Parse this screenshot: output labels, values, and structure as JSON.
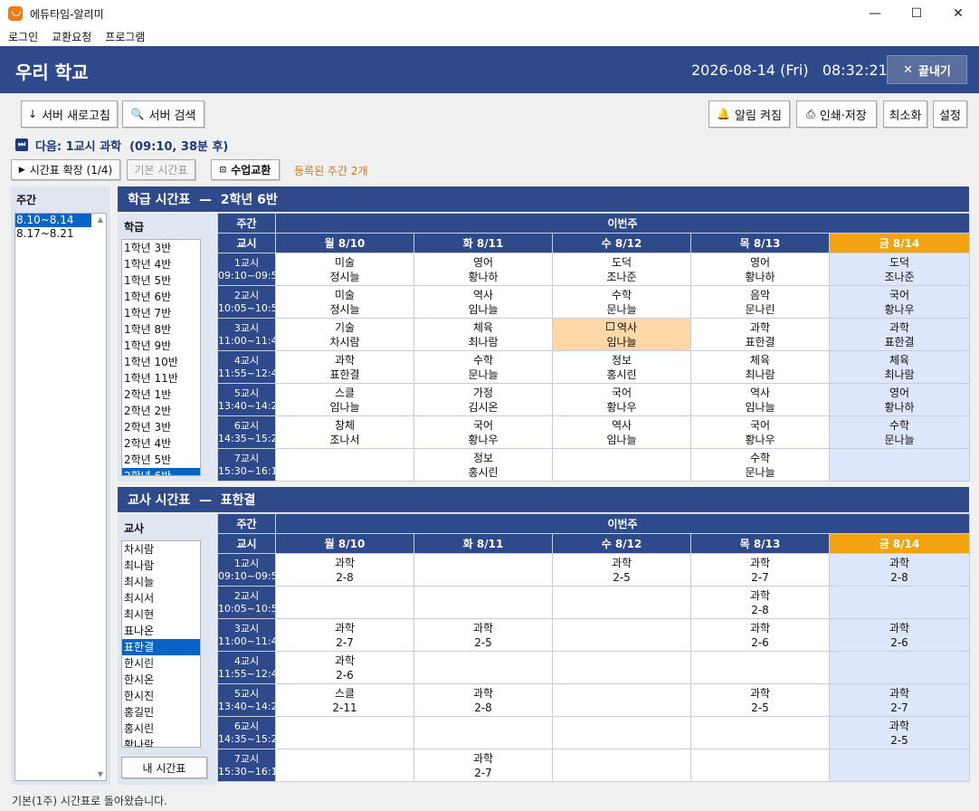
{
  "window": {
    "title": "에듀타임-알리미",
    "minimize": "—",
    "maximize": "☐",
    "close": "✕"
  },
  "menu": [
    "로그인",
    "교환요청",
    "프로그램"
  ],
  "header": {
    "school": "우리 학교",
    "datetime": "2026-08-14 (Fri)   08:32:21",
    "exit_label": "끝내기"
  },
  "toolbar": {
    "refresh": "서버 새로고침",
    "search": "서버 검색",
    "alarm": "알림 켜짐",
    "print": "인쇄·저장",
    "minimize": "최소화",
    "settings": "설정"
  },
  "next_info": "다음: 1교시 과학  (09:10, 38분 후)",
  "sub_toolbar": {
    "expand": "시간표 확장 (1/4)",
    "basic": "기본 시간표",
    "swap": "수업교환",
    "registered": "등록된 주간 2개"
  },
  "weeks": {
    "label": "주간",
    "items": [
      "8.10~8.14",
      "8.17~8.21"
    ],
    "selected": 0
  },
  "class_section": {
    "title": "학급 시간표  —  2학년 6반",
    "list_label": "학급",
    "list": [
      "1학년 3반",
      "1학년 4반",
      "1학년 5반",
      "1학년 6반",
      "1학년 7반",
      "1학년 8반",
      "1학년 9반",
      "1학년 10반",
      "1학년 11반",
      "2학년 1반",
      "2학년 2반",
      "2학년 3반",
      "2학년 4반",
      "2학년 5반",
      "2학년 6반"
    ],
    "selected": 14
  },
  "teacher_section": {
    "title": "교사 시간표  —  표한결",
    "list_label": "교사",
    "list": [
      "차시람",
      "최나람",
      "최시늘",
      "최시서",
      "최시현",
      "표나온",
      "표한결",
      "한시린",
      "한시온",
      "한시진",
      "홍길민",
      "홍시린",
      "황나람"
    ],
    "selected": 6,
    "my_timetable": "내 시간표"
  },
  "grid_header": {
    "week_col": "주간",
    "week_name": "이번주",
    "period_col": "교시",
    "days": [
      "월 8/10",
      "화 8/11",
      "수 8/12",
      "목 8/13",
      "금 8/14"
    ],
    "today_index": 4
  },
  "periods": [
    {
      "name": "1교시",
      "time": "09:10~09:55"
    },
    {
      "name": "2교시",
      "time": "10:05~10:50"
    },
    {
      "name": "3교시",
      "time": "11:00~11:45"
    },
    {
      "name": "4교시",
      "time": "11:55~12:40"
    },
    {
      "name": "5교시",
      "time": "13:40~14:25"
    },
    {
      "name": "6교시",
      "time": "14:35~15:20"
    },
    {
      "name": "7교시",
      "time": "15:30~16:15"
    }
  ],
  "class_grid": [
    [
      [
        "미술",
        "정시늘"
      ],
      [
        "영어",
        "황나하"
      ],
      [
        "도덕",
        "조나준"
      ],
      [
        "영어",
        "황나하"
      ],
      [
        "도덕",
        "조나준"
      ]
    ],
    [
      [
        "미술",
        "정시늘"
      ],
      [
        "역사",
        "임나늘"
      ],
      [
        "수학",
        "문나늘"
      ],
      [
        "음악",
        "문나린"
      ],
      [
        "국어",
        "황나우"
      ]
    ],
    [
      [
        "기술",
        "차시람"
      ],
      [
        "체육",
        "최나람"
      ],
      [
        "역사",
        "임나늘"
      ],
      [
        "과학",
        "표한결"
      ],
      [
        "과학",
        "표한결"
      ]
    ],
    [
      [
        "과학",
        "표한결"
      ],
      [
        "수학",
        "문나늘"
      ],
      [
        "정보",
        "홍시린"
      ],
      [
        "체육",
        "최나람"
      ],
      [
        "체육",
        "최나람"
      ]
    ],
    [
      [
        "스클",
        "임나늘"
      ],
      [
        "가정",
        "김시온"
      ],
      [
        "국어",
        "황나우"
      ],
      [
        "역사",
        "임나늘"
      ],
      [
        "영어",
        "황나하"
      ]
    ],
    [
      [
        "창체",
        "조나서"
      ],
      [
        "국어",
        "황나우"
      ],
      [
        "역사",
        "임나늘"
      ],
      [
        "국어",
        "황나우"
      ],
      [
        "수학",
        "문나늘"
      ]
    ],
    [
      [],
      [
        "정보",
        "홍시린"
      ],
      [],
      [
        "수학",
        "문나늘"
      ],
      []
    ]
  ],
  "class_highlight": {
    "row": 2,
    "col": 2,
    "marker": "⊡"
  },
  "teacher_grid": [
    [
      [
        "과학",
        "2-8"
      ],
      [],
      [
        "과학",
        "2-5"
      ],
      [
        "과학",
        "2-7"
      ],
      [
        "과학",
        "2-8"
      ]
    ],
    [
      [],
      [],
      [],
      [
        "과학",
        "2-8"
      ],
      []
    ],
    [
      [
        "과학",
        "2-7"
      ],
      [
        "과학",
        "2-5"
      ],
      [],
      [
        "과학",
        "2-6"
      ],
      [
        "과학",
        "2-6"
      ]
    ],
    [
      [
        "과학",
        "2-6"
      ],
      [],
      [],
      [],
      []
    ],
    [
      [
        "스클",
        "2-11"
      ],
      [
        "과학",
        "2-8"
      ],
      [],
      [
        "과학",
        "2-5"
      ],
      [
        "과학",
        "2-7"
      ]
    ],
    [
      [],
      [],
      [],
      [],
      [
        "과학",
        "2-5"
      ]
    ],
    [
      [],
      [
        "과학",
        "2-7"
      ],
      [],
      [],
      []
    ]
  ],
  "status": "기본(1주) 시간표로 돌아왔습니다."
}
